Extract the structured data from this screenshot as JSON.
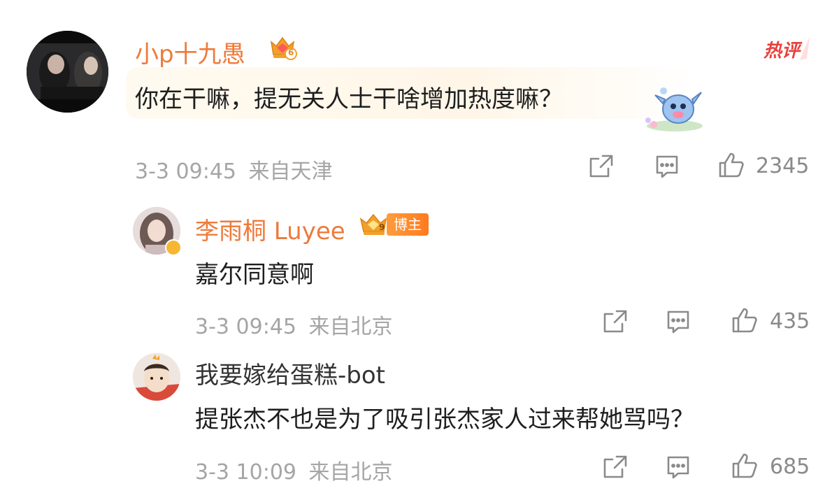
{
  "main_comment": {
    "username": "小p十九愚",
    "text": "你在干嘛，提无关人士干啥增加热度嘛？",
    "timestamp": "3-3 09:45",
    "location": "来自天津",
    "like_count": "2345",
    "vip_level": "6",
    "hot_badge": "热评",
    "username_color": "#ee7a3a"
  },
  "replies": [
    {
      "username": "李雨桐 Luyee",
      "role_tag": "博主",
      "vip_level": "9",
      "text": "嘉尔同意啊",
      "timestamp": "3-3 09:45",
      "location": "来自北京",
      "like_count": "435"
    },
    {
      "username": "我要嫁给蛋糕-bot",
      "text": "提张杰不也是为了吸引张杰家人过来帮她骂吗？",
      "timestamp": "3-3 10:09",
      "location": "来自北京",
      "like_count": "685"
    }
  ],
  "icons": {
    "share": "share-icon",
    "comment": "comment-icon",
    "like": "thumbs-up-icon",
    "crown": "crown-icon",
    "sticker": "stitch-sticker-icon"
  },
  "colors": {
    "accent_orange": "#ee7a3a",
    "meta_gray": "#a5a5a5",
    "hot_red": "#e8413c",
    "verify_gold": "#f7b733"
  }
}
